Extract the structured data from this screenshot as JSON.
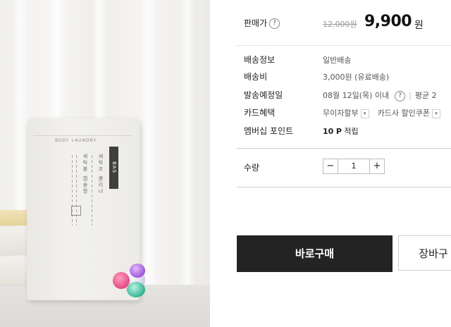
{
  "product": {
    "pouch_brand_small": "BODY LAUNDRY",
    "pouch_tag": "BAS",
    "pouch_columns": [
      "세탁볼 캡슐형",
      "세탁조 클리너"
    ]
  },
  "price": {
    "label": "판매가",
    "original": "12,000원",
    "sale": "9,900",
    "unit": "원"
  },
  "shipping": {
    "info_label": "배송정보",
    "info_value": "일반배송",
    "fee_label": "배송비",
    "fee_value": "3,000원 (유료배송)",
    "expected_label": "발송예정일",
    "expected_value": "08월 12일(목) 이내",
    "expected_extra": "평균 2"
  },
  "card": {
    "label": "카드혜택",
    "option1": "무이자할부",
    "option2": "카드사 할인쿠폰"
  },
  "membership": {
    "label": "멤버십 포인트",
    "points": "10",
    "points_unit": "P",
    "points_suffix": "적립"
  },
  "quantity": {
    "label": "수량",
    "minus": "−",
    "value": "1",
    "plus": "+"
  },
  "actions": {
    "buy_now": "바로구매",
    "cart": "장바구"
  },
  "icons": {
    "help": "?",
    "dropdown": "▾"
  },
  "colors": {
    "buy_button_bg": "#232323",
    "text_primary": "#222222",
    "text_muted": "#9a9a9a"
  }
}
